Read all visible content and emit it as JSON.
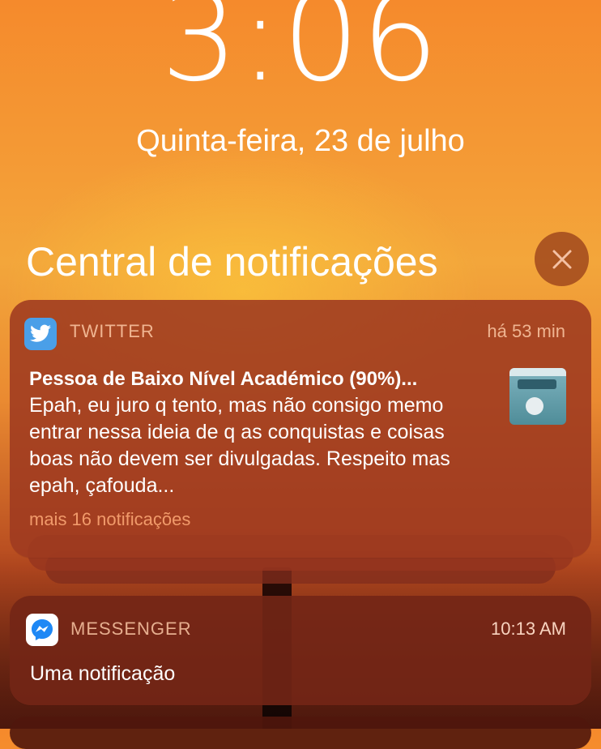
{
  "lockscreen": {
    "time": "3:06",
    "date": "Quinta-feira, 23 de julho"
  },
  "notification_center": {
    "title": "Central de notificações",
    "close_icon": "close-icon"
  },
  "notifications": [
    {
      "app": "TWITTER",
      "icon": "twitter-bird-icon",
      "timestamp": "há 53 min",
      "title": "Pessoa de Baixo Nível Académico (90%)...",
      "body": "Epah, eu juro q tento, mas não consigo memo entrar nessa ideia de q as conquistas e coisas boas não devem ser divulgadas. Respeito mas epah, çafouda...",
      "more": "mais 16 notificações",
      "thumbnail": "attachment-thumbnail"
    },
    {
      "app": "MESSENGER",
      "icon": "messenger-icon",
      "timestamp": "10:13 AM",
      "body": "Uma notificação"
    }
  ],
  "colors": {
    "twitter_blue": "#4a9fe8",
    "messenger_blue": "#1e88f5",
    "card_bg": "#9e3a20"
  }
}
